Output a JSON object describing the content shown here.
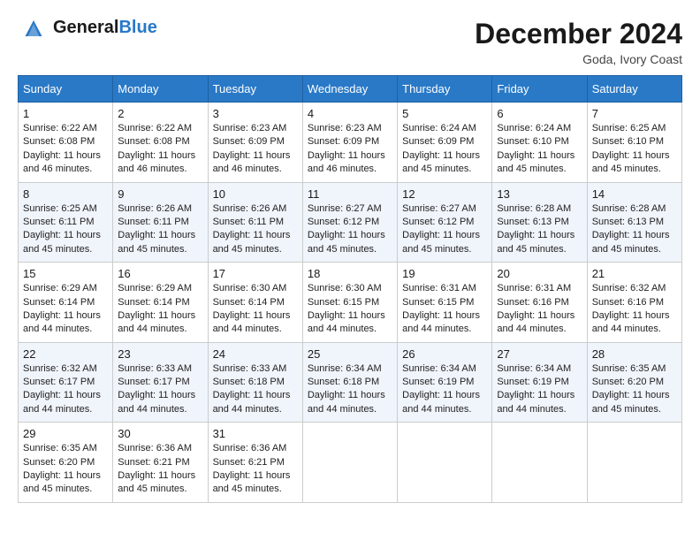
{
  "header": {
    "logo_general": "General",
    "logo_blue": "Blue",
    "month_title": "December 2024",
    "location": "Goda, Ivory Coast"
  },
  "days_of_week": [
    "Sunday",
    "Monday",
    "Tuesday",
    "Wednesday",
    "Thursday",
    "Friday",
    "Saturday"
  ],
  "weeks": [
    [
      {
        "day": "1",
        "sunrise": "6:22 AM",
        "sunset": "6:08 PM",
        "daylight": "11 hours and 46 minutes."
      },
      {
        "day": "2",
        "sunrise": "6:22 AM",
        "sunset": "6:08 PM",
        "daylight": "11 hours and 46 minutes."
      },
      {
        "day": "3",
        "sunrise": "6:23 AM",
        "sunset": "6:09 PM",
        "daylight": "11 hours and 46 minutes."
      },
      {
        "day": "4",
        "sunrise": "6:23 AM",
        "sunset": "6:09 PM",
        "daylight": "11 hours and 46 minutes."
      },
      {
        "day": "5",
        "sunrise": "6:24 AM",
        "sunset": "6:09 PM",
        "daylight": "11 hours and 45 minutes."
      },
      {
        "day": "6",
        "sunrise": "6:24 AM",
        "sunset": "6:10 PM",
        "daylight": "11 hours and 45 minutes."
      },
      {
        "day": "7",
        "sunrise": "6:25 AM",
        "sunset": "6:10 PM",
        "daylight": "11 hours and 45 minutes."
      }
    ],
    [
      {
        "day": "8",
        "sunrise": "6:25 AM",
        "sunset": "6:11 PM",
        "daylight": "11 hours and 45 minutes."
      },
      {
        "day": "9",
        "sunrise": "6:26 AM",
        "sunset": "6:11 PM",
        "daylight": "11 hours and 45 minutes."
      },
      {
        "day": "10",
        "sunrise": "6:26 AM",
        "sunset": "6:11 PM",
        "daylight": "11 hours and 45 minutes."
      },
      {
        "day": "11",
        "sunrise": "6:27 AM",
        "sunset": "6:12 PM",
        "daylight": "11 hours and 45 minutes."
      },
      {
        "day": "12",
        "sunrise": "6:27 AM",
        "sunset": "6:12 PM",
        "daylight": "11 hours and 45 minutes."
      },
      {
        "day": "13",
        "sunrise": "6:28 AM",
        "sunset": "6:13 PM",
        "daylight": "11 hours and 45 minutes."
      },
      {
        "day": "14",
        "sunrise": "6:28 AM",
        "sunset": "6:13 PM",
        "daylight": "11 hours and 45 minutes."
      }
    ],
    [
      {
        "day": "15",
        "sunrise": "6:29 AM",
        "sunset": "6:14 PM",
        "daylight": "11 hours and 44 minutes."
      },
      {
        "day": "16",
        "sunrise": "6:29 AM",
        "sunset": "6:14 PM",
        "daylight": "11 hours and 44 minutes."
      },
      {
        "day": "17",
        "sunrise": "6:30 AM",
        "sunset": "6:14 PM",
        "daylight": "11 hours and 44 minutes."
      },
      {
        "day": "18",
        "sunrise": "6:30 AM",
        "sunset": "6:15 PM",
        "daylight": "11 hours and 44 minutes."
      },
      {
        "day": "19",
        "sunrise": "6:31 AM",
        "sunset": "6:15 PM",
        "daylight": "11 hours and 44 minutes."
      },
      {
        "day": "20",
        "sunrise": "6:31 AM",
        "sunset": "6:16 PM",
        "daylight": "11 hours and 44 minutes."
      },
      {
        "day": "21",
        "sunrise": "6:32 AM",
        "sunset": "6:16 PM",
        "daylight": "11 hours and 44 minutes."
      }
    ],
    [
      {
        "day": "22",
        "sunrise": "6:32 AM",
        "sunset": "6:17 PM",
        "daylight": "11 hours and 44 minutes."
      },
      {
        "day": "23",
        "sunrise": "6:33 AM",
        "sunset": "6:17 PM",
        "daylight": "11 hours and 44 minutes."
      },
      {
        "day": "24",
        "sunrise": "6:33 AM",
        "sunset": "6:18 PM",
        "daylight": "11 hours and 44 minutes."
      },
      {
        "day": "25",
        "sunrise": "6:34 AM",
        "sunset": "6:18 PM",
        "daylight": "11 hours and 44 minutes."
      },
      {
        "day": "26",
        "sunrise": "6:34 AM",
        "sunset": "6:19 PM",
        "daylight": "11 hours and 44 minutes."
      },
      {
        "day": "27",
        "sunrise": "6:34 AM",
        "sunset": "6:19 PM",
        "daylight": "11 hours and 44 minutes."
      },
      {
        "day": "28",
        "sunrise": "6:35 AM",
        "sunset": "6:20 PM",
        "daylight": "11 hours and 45 minutes."
      }
    ],
    [
      {
        "day": "29",
        "sunrise": "6:35 AM",
        "sunset": "6:20 PM",
        "daylight": "11 hours and 45 minutes."
      },
      {
        "day": "30",
        "sunrise": "6:36 AM",
        "sunset": "6:21 PM",
        "daylight": "11 hours and 45 minutes."
      },
      {
        "day": "31",
        "sunrise": "6:36 AM",
        "sunset": "6:21 PM",
        "daylight": "11 hours and 45 minutes."
      },
      null,
      null,
      null,
      null
    ]
  ]
}
